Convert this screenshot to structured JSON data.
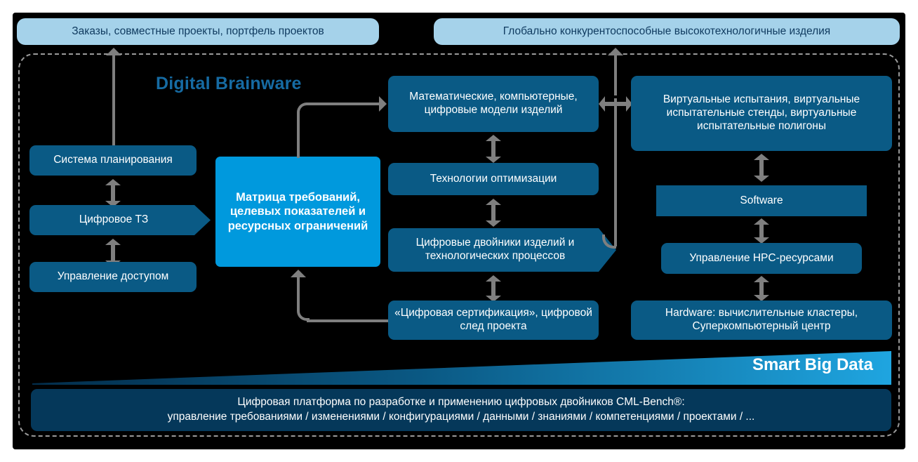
{
  "title_overlay": "Digital Brainware",
  "top_banners": [
    {
      "label": "Заказы, совместные проекты, портфель проектов"
    },
    {
      "label": "Глобально конкурентоспособные высокотехнологичные изделия"
    }
  ],
  "left_column": [
    {
      "label": "Система планирования",
      "shape": "rounded"
    },
    {
      "label": "Цифровое ТЗ",
      "shape": "chevron"
    },
    {
      "label": "Управление доступом",
      "shape": "rounded"
    }
  ],
  "center_block": {
    "label": "Матрица требований, целевых показателей и ресурсных ограничений"
  },
  "middle_column": [
    {
      "label": "Математические, компьютерные, цифровые модели изделий",
      "shape": "rounded"
    },
    {
      "label": "Технологии оптимизации",
      "shape": "rounded"
    },
    {
      "label": "Цифровые двойники изделий и технологических процессов",
      "shape": "chevron"
    },
    {
      "label": "«Цифровая сертификация», цифровой след проекта",
      "shape": "rounded"
    }
  ],
  "right_column": [
    {
      "label": "Виртуальные испытания, виртуальные испытательные стенды, виртуальные испытательные полигоны",
      "shape": "rounded"
    },
    {
      "label": "Software",
      "shape": "sharp"
    },
    {
      "label": "Управление HPC-ресурсами",
      "shape": "rounded"
    },
    {
      "label": "Hardware: вычислительные кластеры, Суперкомпьютерный центр",
      "shape": "rounded"
    }
  ],
  "wedge_label": "Smart Big Data",
  "platform": {
    "line1": "Цифровая платформа по разработке и применению цифровых двойников CML-Bench®:",
    "line2": "управление требованиями / изменениями / конфигурациями / данными / знаниями / компетенциями / проектами / ..."
  },
  "colors": {
    "banner_bg": "#a5d2ea",
    "banner_text": "#0f3a5f",
    "box_dark": "#0a5a85",
    "box_light": "#0099dd",
    "platform_bg": "#05385a",
    "connector": "#7f7f7f",
    "title_text": "#166ba3",
    "backdrop": "#000000",
    "wedge_start": "#032e4c",
    "wedge_end": "#1fa5e0"
  }
}
